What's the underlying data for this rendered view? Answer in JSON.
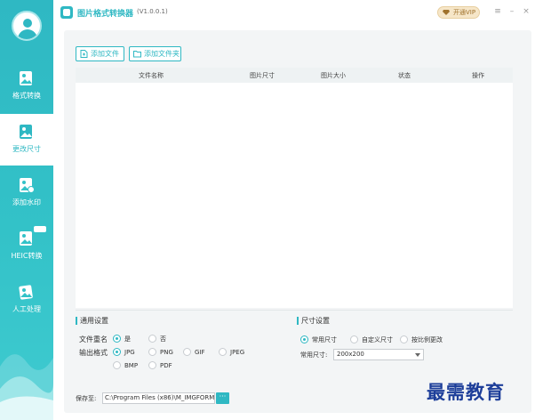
{
  "app": {
    "title": "图片格式转换器",
    "version": "(V1.0.0.1)"
  },
  "titlebar": {
    "vip_label": "开通VIP",
    "menu_glyph": "≡",
    "minimize_glyph": "–",
    "close_glyph": "×"
  },
  "sidebar": {
    "items": [
      {
        "label": "格式转换",
        "icon": "image-convert-icon"
      },
      {
        "label": "更改尺寸",
        "icon": "image-resize-icon",
        "active": true
      },
      {
        "label": "添加水印",
        "icon": "image-watermark-icon"
      },
      {
        "label": "HEIC转换",
        "icon": "heic-icon"
      },
      {
        "label": "人工处理",
        "icon": "manual-process-icon"
      }
    ]
  },
  "toolbar": {
    "add_file": "添加文件",
    "add_folder": "添加文件夹"
  },
  "table": {
    "columns": [
      "文件名称",
      "图片尺寸",
      "图片大小",
      "状态",
      "操作"
    ]
  },
  "general": {
    "title": "通用设置",
    "rename_label": "文件重名",
    "rename_options": [
      {
        "label": "是",
        "selected": true
      },
      {
        "label": "否",
        "selected": false
      }
    ],
    "format_label": "输出格式",
    "format_options": [
      {
        "label": "JPG",
        "selected": true
      },
      {
        "label": "PNG",
        "selected": false
      },
      {
        "label": "GIF",
        "selected": false
      },
      {
        "label": "JPEG",
        "selected": false
      },
      {
        "label": "BMP",
        "selected": false
      },
      {
        "label": "PDF",
        "selected": false
      }
    ]
  },
  "size": {
    "title": "尺寸设置",
    "options": [
      {
        "label": "常用尺寸",
        "selected": true
      },
      {
        "label": "自定义尺寸",
        "selected": false
      },
      {
        "label": "按比例更改",
        "selected": false
      }
    ],
    "common_label": "常用尺寸:",
    "common_value": "200x200"
  },
  "save": {
    "label": "保存至:",
    "path": "C:\\Program Files (x86)\\M_IMGFORMA",
    "browse": "···"
  },
  "watermark_text": "最需教育",
  "colors": {
    "accent": "#2fb8c3",
    "sidebar": "#33c2c8",
    "vip": "#f6e6c8",
    "watermark": "#1e3f9a"
  }
}
